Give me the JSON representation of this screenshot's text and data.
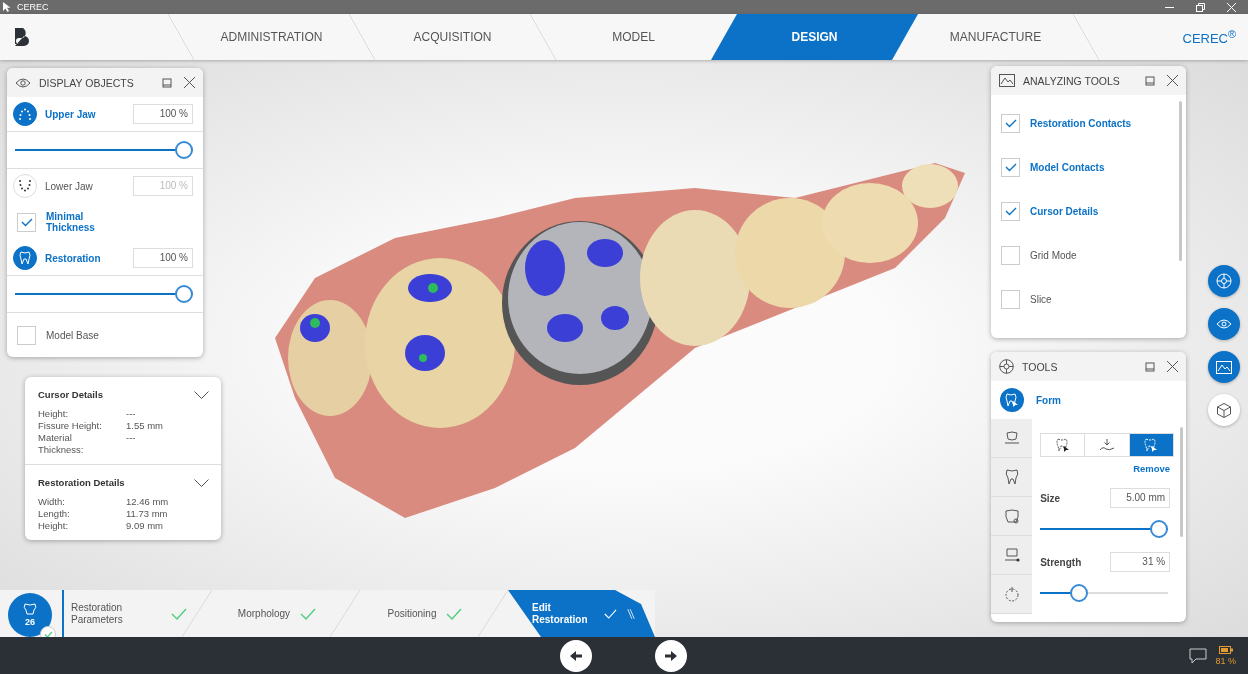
{
  "window": {
    "title": "CEREC"
  },
  "nav": {
    "tabs": [
      {
        "label": "ADMINISTRATION",
        "selected": false
      },
      {
        "label": "ACQUISITION",
        "selected": false
      },
      {
        "label": "MODEL",
        "selected": false
      },
      {
        "label": "DESIGN",
        "selected": true
      },
      {
        "label": "MANUFACTURE",
        "selected": false
      }
    ],
    "brand": "CEREC$^{®}$"
  },
  "display_objects": {
    "title": "DISPLAY OBJECTS",
    "items": [
      {
        "kind": "layer",
        "label": "Upper Jaw",
        "value": "100 %",
        "selected": true,
        "level": 1
      },
      {
        "kind": "layer",
        "label": "Lower Jaw",
        "value": "100 %",
        "selected": false
      },
      {
        "kind": "checkbox",
        "label": "Minimal Thickness",
        "checked": true
      },
      {
        "kind": "layer",
        "label": "Restoration",
        "value": "100 %",
        "selected": true,
        "level": 1
      },
      {
        "kind": "checkbox",
        "label": "Model Base",
        "checked": false
      }
    ]
  },
  "details": {
    "sections": [
      {
        "title": "Cursor Details",
        "rows": [
          {
            "label": "Height:",
            "value": "---"
          },
          {
            "label": "Fissure Height:",
            "value": "1.55 mm"
          },
          {
            "label": "Material Thickness:",
            "value": "---"
          }
        ]
      },
      {
        "title": "Restoration Details",
        "rows": [
          {
            "label": "Width:",
            "value": "12.46 mm"
          },
          {
            "label": "Length:",
            "value": "11.73 mm"
          },
          {
            "label": "Height:",
            "value": "9.09 mm"
          }
        ]
      }
    ]
  },
  "analyzing_tools": {
    "title": "ANALYZING TOOLS",
    "items": [
      {
        "label": "Restoration Contacts",
        "checked": true
      },
      {
        "label": "Model Contacts",
        "checked": true
      },
      {
        "label": "Cursor Details",
        "checked": true
      },
      {
        "label": "Grid Mode",
        "checked": false
      },
      {
        "label": "Slice",
        "checked": false
      }
    ]
  },
  "tools": {
    "title": "TOOLS",
    "active_tool": "Form",
    "modes": [
      {
        "selected": false
      },
      {
        "selected": false
      },
      {
        "selected": true
      }
    ],
    "action": "Remove",
    "params": [
      {
        "label": "Size",
        "value": "5.00 mm",
        "level": 1
      },
      {
        "label": "Strength",
        "value": "31 %",
        "level": 0.27
      }
    ]
  },
  "view_buttons": [
    {
      "selected": true
    },
    {
      "selected": true
    },
    {
      "selected": true
    },
    {
      "selected": false
    }
  ],
  "workflow": {
    "tooth": "26",
    "steps": [
      {
        "label": "Restoration Parameters",
        "done": true,
        "selected": false
      },
      {
        "label": "Morphology",
        "done": true,
        "selected": false
      },
      {
        "label": "Positioning",
        "done": true,
        "selected": false
      },
      {
        "label": "Edit Restoration",
        "done": true,
        "selected": true
      }
    ]
  },
  "status": {
    "battery": "81 %"
  }
}
